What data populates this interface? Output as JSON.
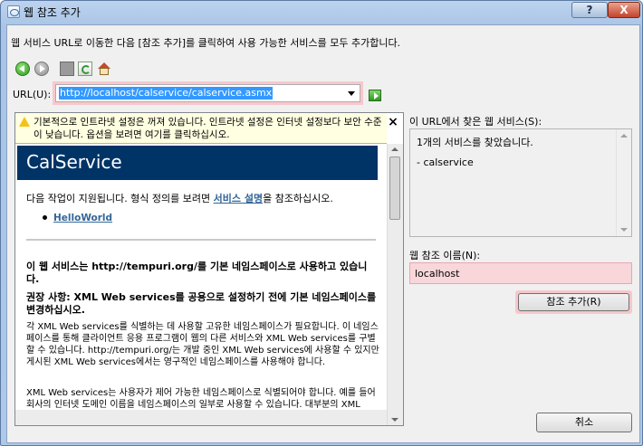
{
  "window": {
    "title": "웹 참조 추가",
    "help_label": "?",
    "close_label": "X"
  },
  "instruction": "웹 서비스 URL로 이동한 다음 [참조 추가]를 클릭하여 사용 가능한 서비스를 모두 추가합니다.",
  "toolbar": {
    "back_icon": "back-arrow-icon",
    "forward_icon": "forward-arrow-icon",
    "stop_icon": "stop-icon",
    "refresh_icon": "refresh-icon",
    "home_icon": "home-icon"
  },
  "url": {
    "label": "URL(U):",
    "value": "http://localhost/calservice/calservice.asmx"
  },
  "infobar": {
    "text": "기본적으로 인트라넷 설정은 꺼져 있습니다. 인트라넷 설정은 인터넷 설정보다 보안 수준이 낮습니다. 옵션을 보려면 여기를 클릭하십시오.",
    "close": "×"
  },
  "page": {
    "service_title": "CalService",
    "intro_before": "다음 작업이 지원됩니다. 형식 정의를 보려면 ",
    "intro_link": "서비스 설명",
    "intro_after": "을 참조하십시오.",
    "operations": [
      "HelloWorld"
    ],
    "heading_namespace": "이 웹 서비스는 http://tempuri.org/를 기본 네임스페이스로 사용하고 있습니다.",
    "heading_recommend": "권장 사항: XML Web services를 공용으로 설정하기 전에 기본 네임스페이스를 변경하십시오.",
    "paragraph1": "각 XML Web services를 식별하는 데 사용할 고유한 네임스페이스가 필요합니다. 이 네임스페이스를 통해 클라이언트 응용 프로그램이 웹의 다른 서비스와 XML Web services를 구별할 수 있습니다. http://tempuri.org/는 개발 중인 XML Web services에 사용할 수 있지만 게시된 XML Web services에서는 영구적인 네임스페이스를 사용해야 합니다.",
    "paragraph2": "XML Web services는 사용자가 제어 가능한 네임스페이스로 식별되어야 합니다. 예를 들어 회사의 인터넷 도메인 이름을 네임스페이스의 일부로 사용할 수 있습니다. 대부분의 XML Web services 네임스페이스는 URL과 비슷하지만 웹의 실제 리소스"
  },
  "services": {
    "label": "이 URL에서 찾은 웹 서비스(S):",
    "count_text": "1개의 서비스를 찾았습니다.",
    "items": [
      "- calservice"
    ]
  },
  "reference_name": {
    "label": "웹 참조 이름(N):",
    "value": "localhost"
  },
  "buttons": {
    "add_reference": "참조 추가(R)",
    "cancel": "취소"
  }
}
